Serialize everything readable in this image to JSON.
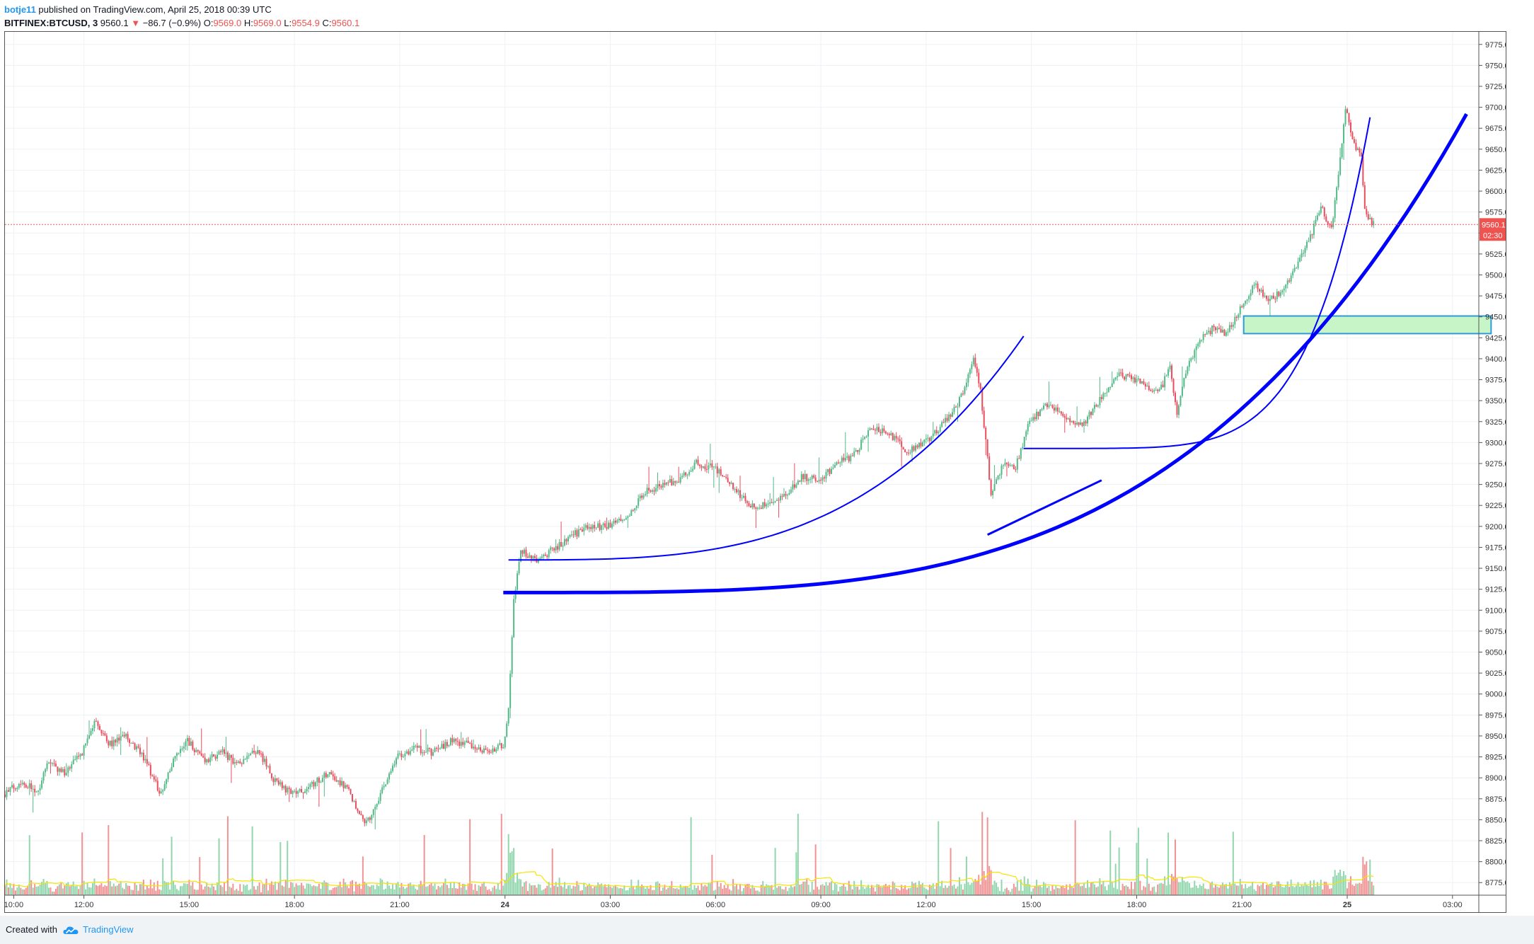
{
  "header": {
    "username": "botje11",
    "published_text": " published on TradingView.com, April 25, 2018 00:39 UTC",
    "symbol": "BITFINEX:BTCUSD, 3",
    "last": "9560.1",
    "arrow": "▼",
    "change": "−86.7 (−0.9%)",
    "o_label": "O:",
    "o_value": "9569.0",
    "h_label": "H:",
    "h_value": "9569.0",
    "l_label": "L:",
    "l_value": "9554.9",
    "c_label": "C:",
    "c_value": "9560.1"
  },
  "footer": {
    "created_with": "Created with",
    "brand": "TradingView"
  },
  "colors": {
    "up": "#26a69a",
    "up_body": "#53b987",
    "down": "#ef5350",
    "down_body": "#eb4d5c",
    "volume_ma": "#f5e400",
    "drawing": "#0000ff",
    "zone_fill": "#c8f5c8",
    "zone_stroke": "#2f9bd6",
    "price_line": "#ef5350",
    "grid": "#eef1f5"
  },
  "chart_data": {
    "type": "candlestick",
    "symbol": "BITFINEX:BTCUSD",
    "interval": "3",
    "y_axis": {
      "range": [
        8760,
        9790
      ],
      "ticks": [
        9775,
        9750,
        9725,
        9700,
        9675,
        9650,
        9625,
        9600,
        9575,
        9550,
        9525,
        9500,
        9475,
        9450,
        9425,
        9400,
        9375,
        9350,
        9325,
        9300,
        9275,
        9250,
        9225,
        9200,
        9175,
        9150,
        9125,
        9100,
        9075,
        9050,
        9025,
        9000,
        8975,
        8950,
        8925,
        8900,
        8875,
        8850,
        8825,
        8800,
        8775
      ],
      "decimals": 1
    },
    "x_axis": {
      "range_hours": [
        9.75,
        51.75
      ],
      "ticks": [
        {
          "label": "10:00",
          "h": 10
        },
        {
          "label": "12:00",
          "h": 12
        },
        {
          "label": "15:00",
          "h": 15
        },
        {
          "label": "18:00",
          "h": 18
        },
        {
          "label": "21:00",
          "h": 21
        },
        {
          "label": "24",
          "h": 24
        },
        {
          "label": "03:00",
          "h": 27
        },
        {
          "label": "06:00",
          "h": 30
        },
        {
          "label": "09:00",
          "h": 33
        },
        {
          "label": "12:00",
          "h": 36
        },
        {
          "label": "15:00",
          "h": 39
        },
        {
          "label": "18:00",
          "h": 42
        },
        {
          "label": "21:00",
          "h": 45
        },
        {
          "label": "25",
          "h": 48
        },
        {
          "label": "03:00",
          "h": 51
        }
      ]
    },
    "grid": true,
    "last_price": {
      "value": 9560.1,
      "label": "9560.1",
      "countdown": "02:30"
    },
    "price_path": [
      [
        9.75,
        8880
      ],
      [
        10.25,
        8895
      ],
      [
        10.75,
        8885
      ],
      [
        11.0,
        8920
      ],
      [
        11.5,
        8905
      ],
      [
        12.0,
        8930
      ],
      [
        12.4,
        8970
      ],
      [
        12.75,
        8940
      ],
      [
        13.25,
        8950
      ],
      [
        13.75,
        8925
      ],
      [
        14.25,
        8880
      ],
      [
        14.6,
        8920
      ],
      [
        15.0,
        8945
      ],
      [
        15.5,
        8920
      ],
      [
        16.0,
        8930
      ],
      [
        16.5,
        8915
      ],
      [
        17.0,
        8935
      ],
      [
        17.5,
        8895
      ],
      [
        18.0,
        8880
      ],
      [
        18.5,
        8890
      ],
      [
        19.0,
        8905
      ],
      [
        19.5,
        8890
      ],
      [
        19.9,
        8860
      ],
      [
        20.1,
        8845
      ],
      [
        20.5,
        8880
      ],
      [
        21.0,
        8925
      ],
      [
        21.5,
        8935
      ],
      [
        22.0,
        8930
      ],
      [
        22.5,
        8945
      ],
      [
        23.0,
        8940
      ],
      [
        23.5,
        8930
      ],
      [
        24.0,
        8940
      ],
      [
        24.15,
        8980
      ],
      [
        24.3,
        9110
      ],
      [
        24.5,
        9170
      ],
      [
        25.0,
        9160
      ],
      [
        25.5,
        9175
      ],
      [
        26.0,
        9190
      ],
      [
        26.5,
        9200
      ],
      [
        27.0,
        9200
      ],
      [
        27.5,
        9210
      ],
      [
        28.0,
        9240
      ],
      [
        28.5,
        9250
      ],
      [
        29.0,
        9255
      ],
      [
        29.5,
        9275
      ],
      [
        30.0,
        9270
      ],
      [
        30.5,
        9250
      ],
      [
        31.0,
        9225
      ],
      [
        31.5,
        9225
      ],
      [
        32.0,
        9235
      ],
      [
        32.5,
        9260
      ],
      [
        33.0,
        9255
      ],
      [
        33.5,
        9275
      ],
      [
        34.0,
        9285
      ],
      [
        34.5,
        9320
      ],
      [
        35.0,
        9310
      ],
      [
        35.5,
        9290
      ],
      [
        36.0,
        9300
      ],
      [
        36.5,
        9320
      ],
      [
        37.0,
        9350
      ],
      [
        37.4,
        9400
      ],
      [
        37.6,
        9360
      ],
      [
        37.9,
        9240
      ],
      [
        38.0,
        9250
      ],
      [
        38.3,
        9280
      ],
      [
        38.6,
        9270
      ],
      [
        39.0,
        9325
      ],
      [
        39.5,
        9345
      ],
      [
        40.0,
        9330
      ],
      [
        40.5,
        9320
      ],
      [
        41.0,
        9350
      ],
      [
        41.5,
        9380
      ],
      [
        42.0,
        9375
      ],
      [
        42.5,
        9360
      ],
      [
        42.8,
        9370
      ],
      [
        43.0,
        9390
      ],
      [
        43.2,
        9330
      ],
      [
        43.4,
        9380
      ],
      [
        43.8,
        9420
      ],
      [
        44.2,
        9435
      ],
      [
        44.6,
        9430
      ],
      [
        45.0,
        9460
      ],
      [
        45.4,
        9490
      ],
      [
        45.8,
        9470
      ],
      [
        46.2,
        9480
      ],
      [
        46.6,
        9510
      ],
      [
        47.0,
        9545
      ],
      [
        47.3,
        9580
      ],
      [
        47.6,
        9555
      ],
      [
        47.8,
        9620
      ],
      [
        48.0,
        9700
      ],
      [
        48.2,
        9660
      ],
      [
        48.45,
        9640
      ],
      [
        48.55,
        9580
      ],
      [
        48.75,
        9560
      ]
    ],
    "drawings": {
      "thin_arc_1": {
        "start": [
          24.1,
          9160
        ],
        "end": [
          38.78,
          9427
        ],
        "exponent": 3.3
      },
      "thin_arc_2": {
        "start": [
          38.78,
          9293
        ],
        "end": [
          48.65,
          9688
        ],
        "exponent": 5.8
      },
      "thick_arc": {
        "start": [
          23.95,
          9121
        ],
        "end": [
          51.4,
          9692
        ],
        "exponent": 3.6
      },
      "thick_base_segment": {
        "from": [
          37.75,
          9190
        ],
        "to": [
          41.0,
          9255
        ]
      },
      "support_zone": {
        "from_h": 45.05,
        "to_h": 52.1,
        "high": 9451,
        "low": 9430
      }
    }
  }
}
